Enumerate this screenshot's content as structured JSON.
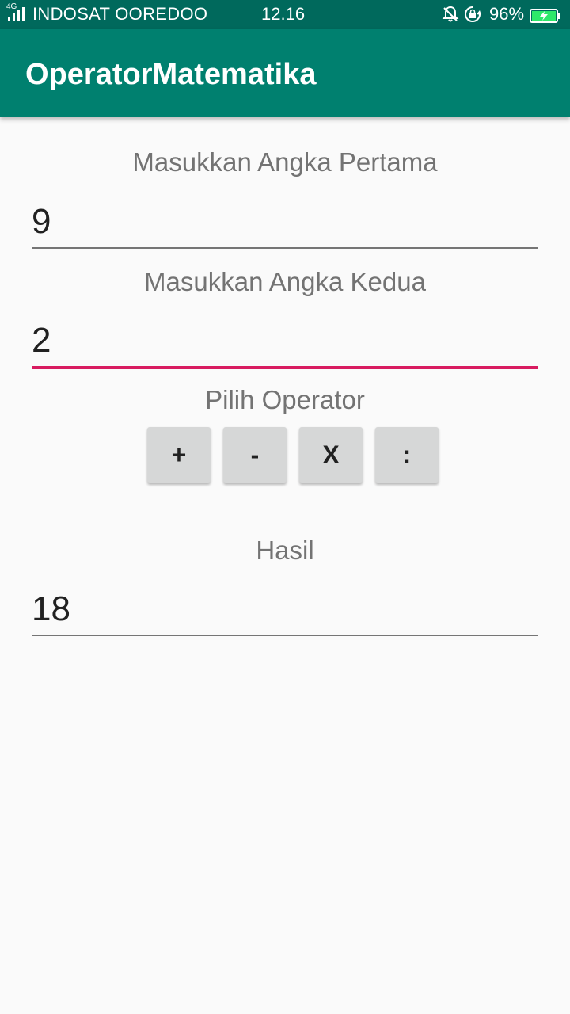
{
  "status_bar": {
    "network_type": "4G",
    "carrier": "INDOSAT OOREDOO",
    "time": "12.16",
    "battery_percent": "96%",
    "icons": [
      "signal-icon",
      "bell-off-icon",
      "rotation-lock-icon",
      "battery-charging-icon"
    ]
  },
  "app_bar": {
    "title": "OperatorMatematika",
    "color": "#00806f"
  },
  "form": {
    "first_label": "Masukkan Angka Pertama",
    "first_value": "9",
    "second_label": "Masukkan Angka Kedua",
    "second_value": "2",
    "operator_label": "Pilih Operator",
    "operators": [
      "+",
      "-",
      "X",
      ":"
    ],
    "result_label": "Hasil",
    "result_value": "18"
  },
  "colors": {
    "accent": "#d81b60",
    "status_bar": "#00695c",
    "button": "#d6d7d7"
  }
}
